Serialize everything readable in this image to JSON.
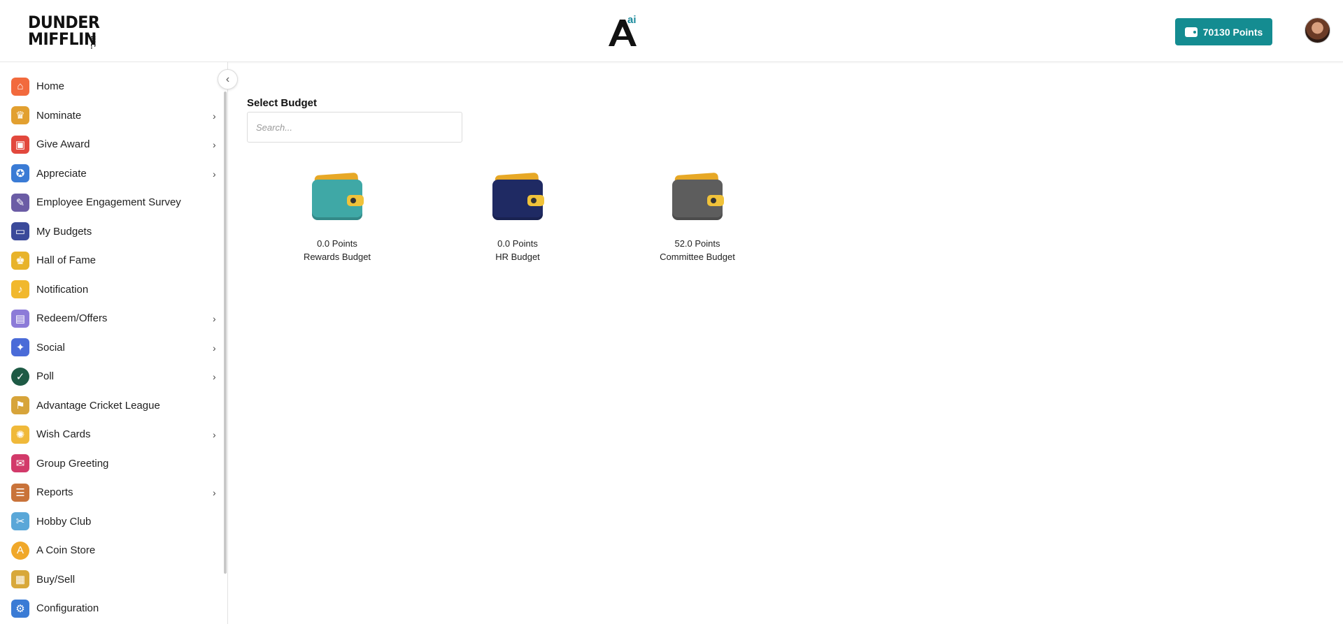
{
  "header": {
    "brand_line1": "DUNDER",
    "brand_line2": "MIFFLIN",
    "brand_suffix": "INC.",
    "center_logo_letter": "A",
    "center_logo_sup": "ai",
    "points_label": "70130 Points",
    "points_icon": "wallet-icon",
    "accent_color": "#148c91"
  },
  "sidebar": {
    "collapse_icon": "chevron-left-icon",
    "items": [
      {
        "label": "Home",
        "icon": "home-icon",
        "has_submenu": false
      },
      {
        "label": "Nominate",
        "icon": "trophy-icon",
        "has_submenu": true
      },
      {
        "label": "Give Award",
        "icon": "gift-icon",
        "has_submenu": true
      },
      {
        "label": "Appreciate",
        "icon": "medal-icon",
        "has_submenu": true
      },
      {
        "label": "Employee Engagement Survey",
        "icon": "survey-icon",
        "has_submenu": false
      },
      {
        "label": "My Budgets",
        "icon": "wallet-icon",
        "has_submenu": false
      },
      {
        "label": "Hall of Fame",
        "icon": "crown-icon",
        "has_submenu": false
      },
      {
        "label": "Notification",
        "icon": "bell-icon",
        "has_submenu": false
      },
      {
        "label": "Redeem/Offers",
        "icon": "voucher-icon",
        "has_submenu": true
      },
      {
        "label": "Social",
        "icon": "like-icon",
        "has_submenu": true
      },
      {
        "label": "Poll",
        "icon": "poll-icon",
        "has_submenu": true
      },
      {
        "label": "Advantage Cricket League",
        "icon": "cricket-icon",
        "has_submenu": false
      },
      {
        "label": "Wish Cards",
        "icon": "party-popper-icon",
        "has_submenu": true
      },
      {
        "label": "Group Greeting",
        "icon": "envelope-icon",
        "has_submenu": false
      },
      {
        "label": "Reports",
        "icon": "clipboard-icon",
        "has_submenu": true
      },
      {
        "label": "Hobby Club",
        "icon": "hobby-icon",
        "has_submenu": false
      },
      {
        "label": "A Coin Store",
        "icon": "coin-icon",
        "has_submenu": false
      },
      {
        "label": "Buy/Sell",
        "icon": "shopping-bag-icon",
        "has_submenu": false
      },
      {
        "label": "Configuration",
        "icon": "config-icon",
        "has_submenu": false
      }
    ],
    "chevron_glyph": "›"
  },
  "main": {
    "select_title": "Select Budget",
    "search_placeholder": "Search...",
    "budgets": [
      {
        "points": "0.0 Points",
        "name": "Rewards Budget",
        "color": "#3fa8a6"
      },
      {
        "points": "0.0 Points",
        "name": "HR Budget",
        "color": "#1f2a63"
      },
      {
        "points": "52.0 Points",
        "name": "Committee Budget",
        "color": "#5d5d5d"
      }
    ]
  }
}
